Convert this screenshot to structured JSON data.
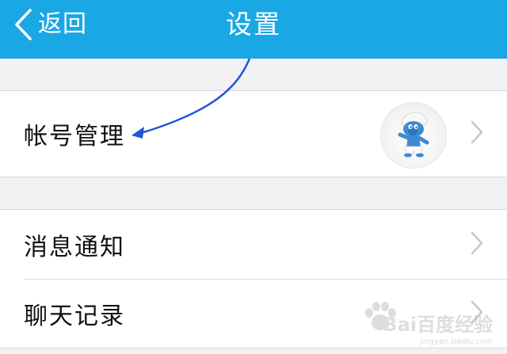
{
  "header": {
    "back_label": "返回",
    "title": "设置"
  },
  "settings": {
    "account": {
      "label": "帐号管理",
      "avatar_icon": "smurf-avatar"
    },
    "items": [
      {
        "label": "消息通知"
      },
      {
        "label": "聊天记录"
      }
    ]
  },
  "watermark": {
    "text": "Bai百度经验",
    "subtext": "jingyan.baidu.com"
  },
  "colors": {
    "header_bg": "#1aa7e6",
    "page_bg": "#f2f2f4",
    "annotation_arrow": "#1f55d6"
  }
}
